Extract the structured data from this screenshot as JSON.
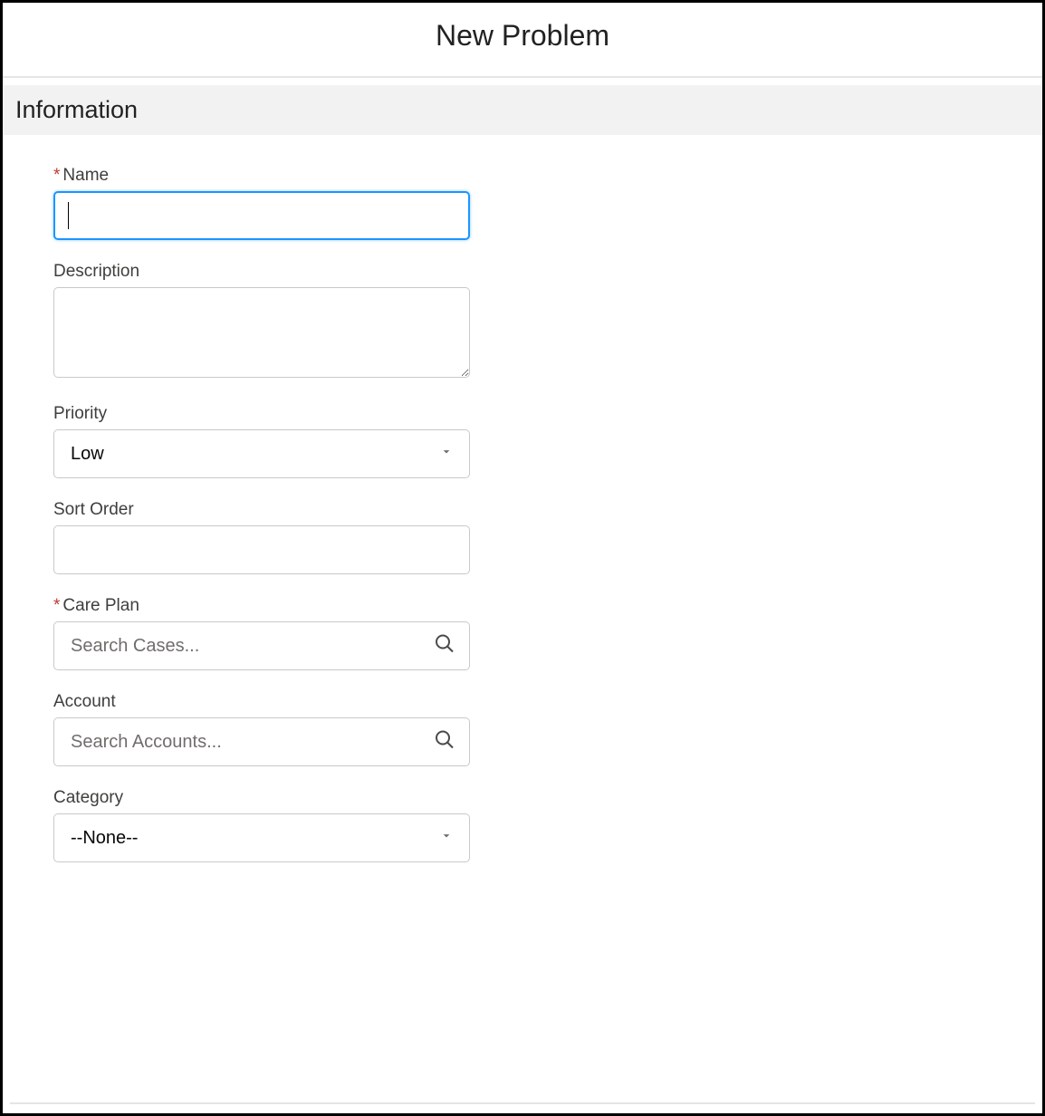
{
  "header": {
    "title": "New Problem"
  },
  "section": {
    "title": "Information"
  },
  "fields": {
    "name": {
      "label": "Name",
      "value": "",
      "required": true
    },
    "description": {
      "label": "Description",
      "value": "",
      "required": false
    },
    "priority": {
      "label": "Priority",
      "value": "Low",
      "required": false
    },
    "sortOrder": {
      "label": "Sort Order",
      "value": "",
      "required": false
    },
    "carePlan": {
      "label": "Care Plan",
      "placeholder": "Search Cases...",
      "value": "",
      "required": true
    },
    "account": {
      "label": "Account",
      "placeholder": "Search Accounts...",
      "value": "",
      "required": false
    },
    "category": {
      "label": "Category",
      "value": "--None--",
      "required": false
    }
  },
  "requiredMark": "*"
}
